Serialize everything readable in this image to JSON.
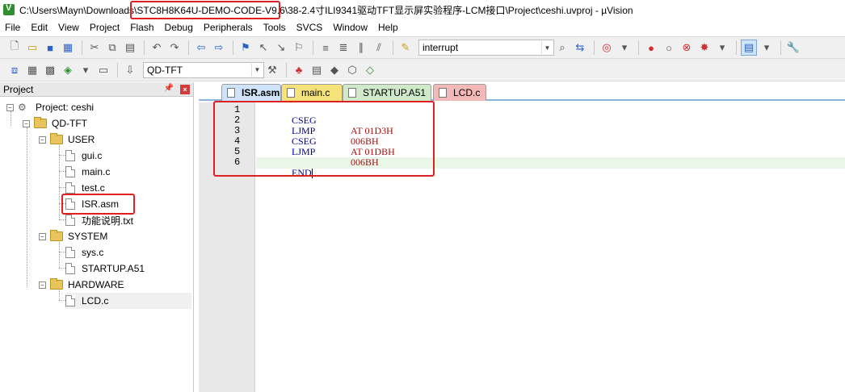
{
  "window": {
    "title": "C:\\Users\\Mayn\\Downloads\\STC8H8K64U-DEMO-CODE-V9.6\\38-2.4寸ILI9341驱动TFT显示屏实验程序-LCM接口\\Project\\ceshi.uvproj - µVision"
  },
  "menu": [
    "File",
    "Edit",
    "View",
    "Project",
    "Flash",
    "Debug",
    "Peripherals",
    "Tools",
    "SVCS",
    "Window",
    "Help"
  ],
  "toolbar": {
    "find_value": "interrupt",
    "target_value": "QD-TFT"
  },
  "project_panel": {
    "title": "Project",
    "root": "Project: ceshi",
    "target": "QD-TFT",
    "groups": [
      {
        "name": "USER",
        "files": [
          "gui.c",
          "main.c",
          "test.c",
          "ISR.asm",
          "功能说明.txt"
        ]
      },
      {
        "name": "SYSTEM",
        "files": [
          "sys.c",
          "STARTUP.A51"
        ]
      },
      {
        "name": "HARDWARE",
        "files": [
          "LCD.c"
        ]
      }
    ]
  },
  "editor": {
    "tabs": [
      "ISR.asm",
      "main.c",
      "STARTUP.A51",
      "LCD.c"
    ],
    "active_tab": "ISR.asm",
    "lines": [
      {
        "no": "1",
        "kw": "CSEG",
        "arg": "AT 01D3H"
      },
      {
        "no": "2",
        "kw": "LJMP",
        "arg": "006BH"
      },
      {
        "no": "3",
        "kw": "CSEG",
        "arg": "AT 01DBH"
      },
      {
        "no": "4",
        "kw": "LJMP",
        "arg": "006BH"
      },
      {
        "no": "5",
        "kw": "",
        "arg": ""
      },
      {
        "no": "6",
        "kw": "END",
        "arg": ""
      }
    ]
  },
  "colors": {
    "annotation": "#e02020",
    "keyword": "#00008b",
    "number": "#a01010"
  }
}
